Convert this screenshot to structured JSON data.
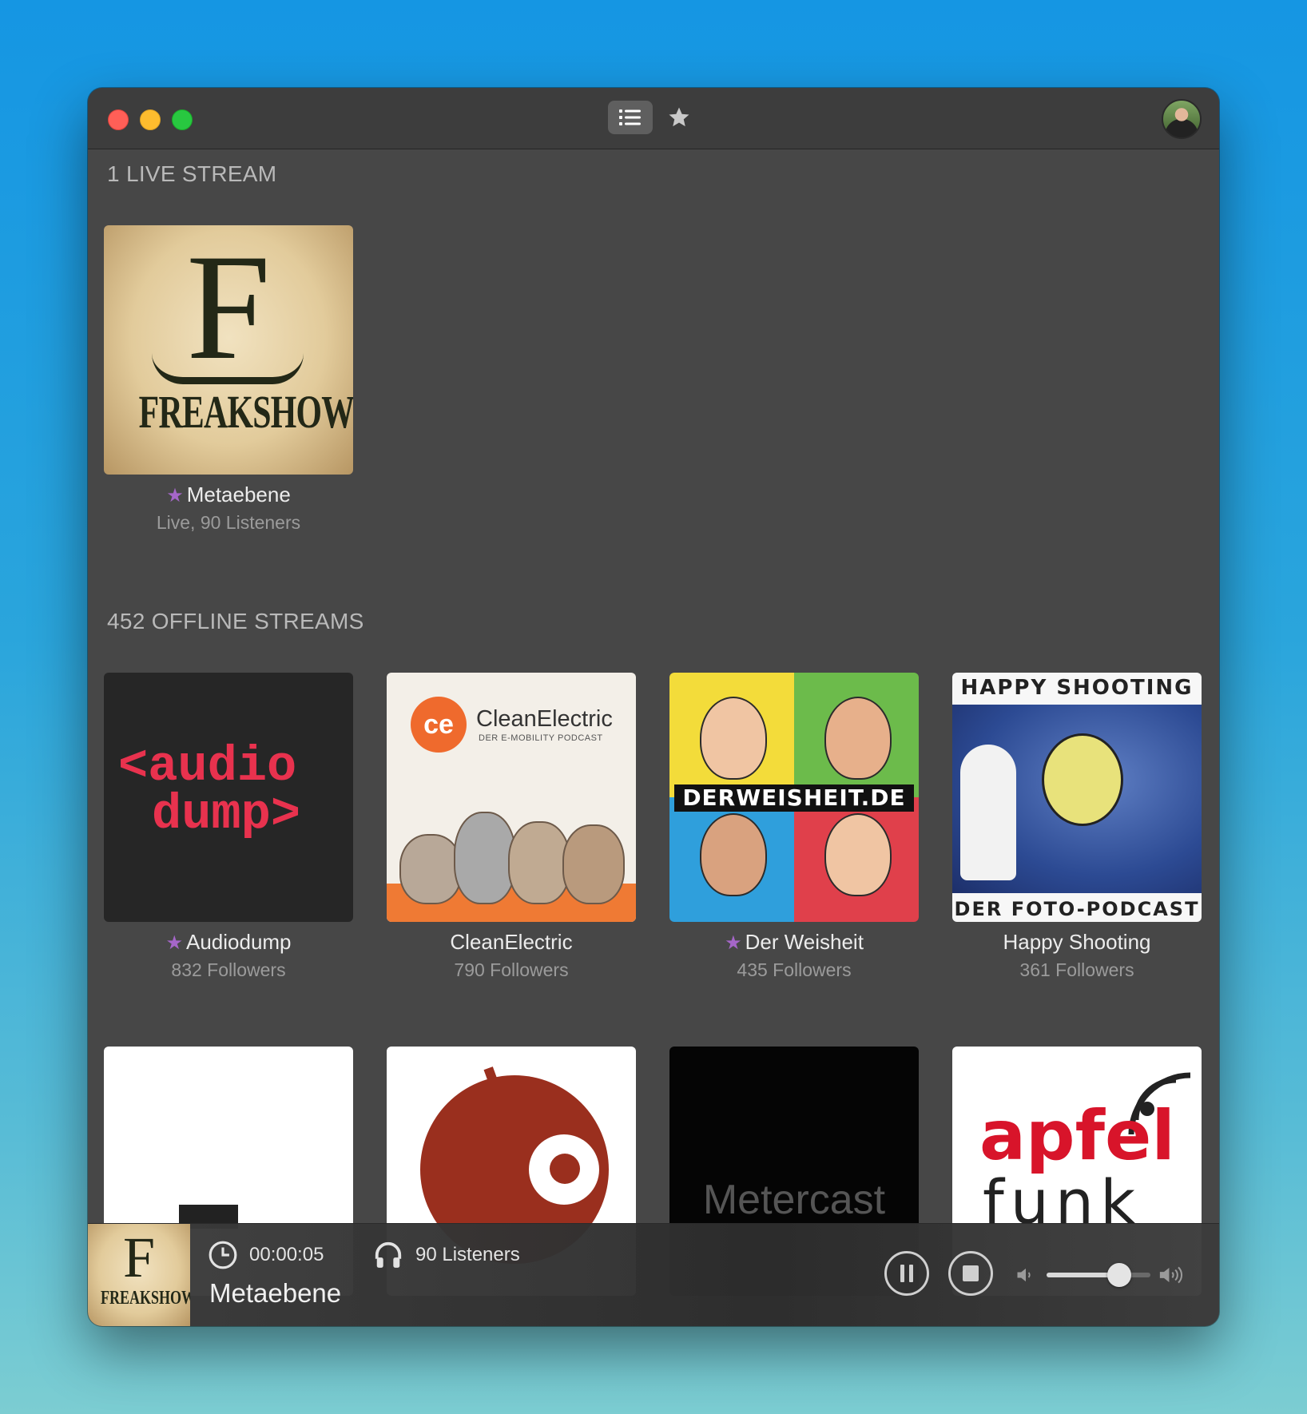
{
  "toolbar": {
    "list_icon": "list-icon",
    "favorites_icon": "star-icon",
    "avatar_icon": "user-avatar"
  },
  "live": {
    "header": "1 LIVE STREAM",
    "tiles": [
      {
        "name": "Metaebene",
        "sub": "Live, 90 Listeners",
        "starred": true,
        "art_text": "FREAKSHOW"
      }
    ]
  },
  "offline": {
    "header": "452 OFFLINE STREAMS",
    "tiles": [
      {
        "name": "Audiodump",
        "sub": "832 Followers",
        "starred": true,
        "art_text_1": "<audio",
        "art_text_2": "dump>"
      },
      {
        "name": "CleanElectric",
        "sub": "790 Followers",
        "starred": false,
        "art_brand": "CleanElectric",
        "art_tag": "DER E-MOBILITY PODCAST"
      },
      {
        "name": "Der Weisheit",
        "sub": "435 Followers",
        "starred": true,
        "art_banner": "DERWEISHEIT.DE"
      },
      {
        "name": "Happy Shooting",
        "sub": "361 Followers",
        "starred": false,
        "art_top": "HAPPY SHOOTING",
        "art_bottom": "DER FOTO-PODCAST"
      }
    ],
    "row2": [
      {
        "art": "white"
      },
      {
        "art": "apple-logo"
      },
      {
        "art_text": "Metercast"
      },
      {
        "art_text_1": "apfel",
        "art_text_2": "funk"
      }
    ]
  },
  "player": {
    "elapsed": "00:00:05",
    "listeners": "90 Listeners",
    "title": "Metaebene",
    "volume_level": 0.7,
    "art_text": "FREAKSHOW",
    "icons": [
      "clock-icon",
      "headphones-icon",
      "pause-icon",
      "stop-icon",
      "volume-low-icon",
      "volume-high-icon"
    ]
  },
  "colors": {
    "background_top": "#1596e3",
    "window": "#474747",
    "star_accent": "#a566c9"
  }
}
